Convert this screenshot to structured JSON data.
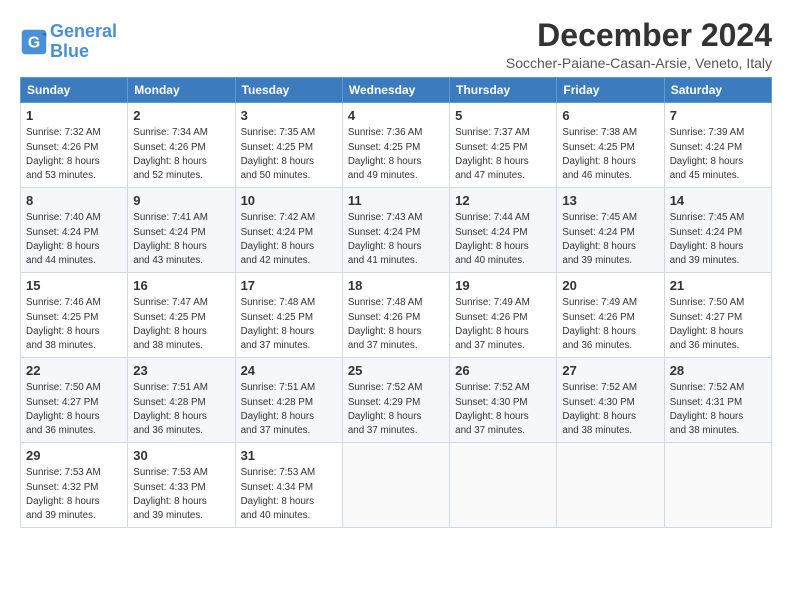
{
  "logo": {
    "line1": "General",
    "line2": "Blue"
  },
  "title": "December 2024",
  "subtitle": "Soccher-Paiane-Casan-Arsie, Veneto, Italy",
  "weekdays": [
    "Sunday",
    "Monday",
    "Tuesday",
    "Wednesday",
    "Thursday",
    "Friday",
    "Saturday"
  ],
  "weeks": [
    [
      {
        "day": "1",
        "info": "Sunrise: 7:32 AM\nSunset: 4:26 PM\nDaylight: 8 hours\nand 53 minutes."
      },
      {
        "day": "2",
        "info": "Sunrise: 7:34 AM\nSunset: 4:26 PM\nDaylight: 8 hours\nand 52 minutes."
      },
      {
        "day": "3",
        "info": "Sunrise: 7:35 AM\nSunset: 4:25 PM\nDaylight: 8 hours\nand 50 minutes."
      },
      {
        "day": "4",
        "info": "Sunrise: 7:36 AM\nSunset: 4:25 PM\nDaylight: 8 hours\nand 49 minutes."
      },
      {
        "day": "5",
        "info": "Sunrise: 7:37 AM\nSunset: 4:25 PM\nDaylight: 8 hours\nand 47 minutes."
      },
      {
        "day": "6",
        "info": "Sunrise: 7:38 AM\nSunset: 4:25 PM\nDaylight: 8 hours\nand 46 minutes."
      },
      {
        "day": "7",
        "info": "Sunrise: 7:39 AM\nSunset: 4:24 PM\nDaylight: 8 hours\nand 45 minutes."
      }
    ],
    [
      {
        "day": "8",
        "info": "Sunrise: 7:40 AM\nSunset: 4:24 PM\nDaylight: 8 hours\nand 44 minutes."
      },
      {
        "day": "9",
        "info": "Sunrise: 7:41 AM\nSunset: 4:24 PM\nDaylight: 8 hours\nand 43 minutes."
      },
      {
        "day": "10",
        "info": "Sunrise: 7:42 AM\nSunset: 4:24 PM\nDaylight: 8 hours\nand 42 minutes."
      },
      {
        "day": "11",
        "info": "Sunrise: 7:43 AM\nSunset: 4:24 PM\nDaylight: 8 hours\nand 41 minutes."
      },
      {
        "day": "12",
        "info": "Sunrise: 7:44 AM\nSunset: 4:24 PM\nDaylight: 8 hours\nand 40 minutes."
      },
      {
        "day": "13",
        "info": "Sunrise: 7:45 AM\nSunset: 4:24 PM\nDaylight: 8 hours\nand 39 minutes."
      },
      {
        "day": "14",
        "info": "Sunrise: 7:45 AM\nSunset: 4:24 PM\nDaylight: 8 hours\nand 39 minutes."
      }
    ],
    [
      {
        "day": "15",
        "info": "Sunrise: 7:46 AM\nSunset: 4:25 PM\nDaylight: 8 hours\nand 38 minutes."
      },
      {
        "day": "16",
        "info": "Sunrise: 7:47 AM\nSunset: 4:25 PM\nDaylight: 8 hours\nand 38 minutes."
      },
      {
        "day": "17",
        "info": "Sunrise: 7:48 AM\nSunset: 4:25 PM\nDaylight: 8 hours\nand 37 minutes."
      },
      {
        "day": "18",
        "info": "Sunrise: 7:48 AM\nSunset: 4:26 PM\nDaylight: 8 hours\nand 37 minutes."
      },
      {
        "day": "19",
        "info": "Sunrise: 7:49 AM\nSunset: 4:26 PM\nDaylight: 8 hours\nand 37 minutes."
      },
      {
        "day": "20",
        "info": "Sunrise: 7:49 AM\nSunset: 4:26 PM\nDaylight: 8 hours\nand 36 minutes."
      },
      {
        "day": "21",
        "info": "Sunrise: 7:50 AM\nSunset: 4:27 PM\nDaylight: 8 hours\nand 36 minutes."
      }
    ],
    [
      {
        "day": "22",
        "info": "Sunrise: 7:50 AM\nSunset: 4:27 PM\nDaylight: 8 hours\nand 36 minutes."
      },
      {
        "day": "23",
        "info": "Sunrise: 7:51 AM\nSunset: 4:28 PM\nDaylight: 8 hours\nand 36 minutes."
      },
      {
        "day": "24",
        "info": "Sunrise: 7:51 AM\nSunset: 4:28 PM\nDaylight: 8 hours\nand 37 minutes."
      },
      {
        "day": "25",
        "info": "Sunrise: 7:52 AM\nSunset: 4:29 PM\nDaylight: 8 hours\nand 37 minutes."
      },
      {
        "day": "26",
        "info": "Sunrise: 7:52 AM\nSunset: 4:30 PM\nDaylight: 8 hours\nand 37 minutes."
      },
      {
        "day": "27",
        "info": "Sunrise: 7:52 AM\nSunset: 4:30 PM\nDaylight: 8 hours\nand 38 minutes."
      },
      {
        "day": "28",
        "info": "Sunrise: 7:52 AM\nSunset: 4:31 PM\nDaylight: 8 hours\nand 38 minutes."
      }
    ],
    [
      {
        "day": "29",
        "info": "Sunrise: 7:53 AM\nSunset: 4:32 PM\nDaylight: 8 hours\nand 39 minutes."
      },
      {
        "day": "30",
        "info": "Sunrise: 7:53 AM\nSunset: 4:33 PM\nDaylight: 8 hours\nand 39 minutes."
      },
      {
        "day": "31",
        "info": "Sunrise: 7:53 AM\nSunset: 4:34 PM\nDaylight: 8 hours\nand 40 minutes."
      },
      {
        "day": "",
        "info": ""
      },
      {
        "day": "",
        "info": ""
      },
      {
        "day": "",
        "info": ""
      },
      {
        "day": "",
        "info": ""
      }
    ]
  ]
}
